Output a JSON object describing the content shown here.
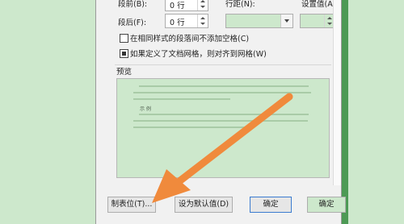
{
  "spacing": {
    "before_label": "段前(B):",
    "before_value": "0 行",
    "after_label": "段后(F):",
    "after_value": "0 行",
    "line_spacing_label": "行距(N):",
    "line_spacing_value": "",
    "setting_label": "设置值(A):",
    "setting_value": ""
  },
  "options": {
    "no_space_same_style": "在相同样式的段落间不添加空格(C)",
    "no_space_checked": false,
    "snap_to_grid": "如果定义了文档网格，则对齐到网格(W)",
    "snap_checked": true
  },
  "preview": {
    "label": "预览",
    "sample_text": "示 例"
  },
  "buttons": {
    "tabs": "制表位(T)...",
    "set_default": "设为默认值(D)",
    "ok": "确定",
    "ok_doc": "确定"
  },
  "colors": {
    "eye_care_green": "#cde8cc",
    "annotation_arrow": "#f08a3c",
    "frame_green": "#4d9a55"
  }
}
